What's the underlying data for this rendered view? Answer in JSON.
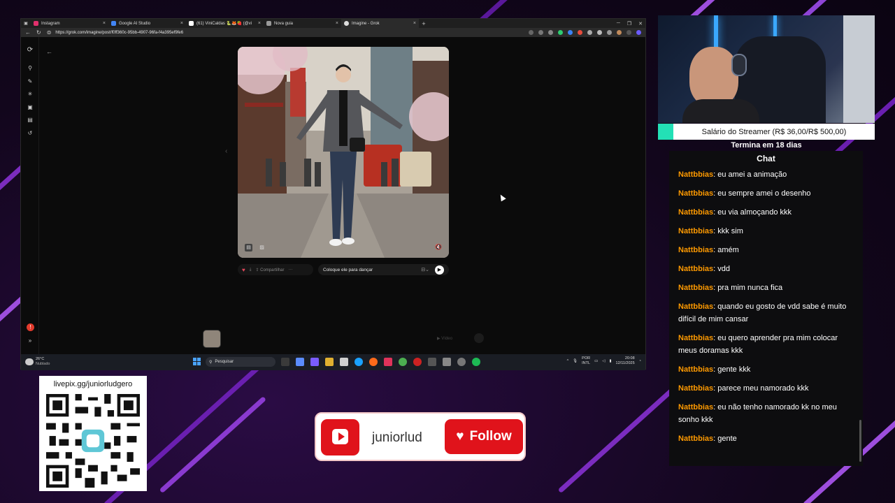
{
  "browser": {
    "tabs": [
      {
        "title": "Instagram",
        "fav_color": "#e1306c",
        "active": false
      },
      {
        "title": "Google AI Studio",
        "fav_color": "#4285f4",
        "active": false
      },
      {
        "title": "(61) ViniCaldas 🐍🦊🍓 (@vi",
        "fav_color": "#ffffff",
        "active": false
      },
      {
        "title": "Nova guia",
        "fav_color": "#999999",
        "active": false
      },
      {
        "title": "Imagine - Grok",
        "fav_color": "#dddddd",
        "active": true
      }
    ],
    "url": "https://grok.com/imagine/post/f0ff360c-95bb-4907-96fa-f4a395ef9fe6"
  },
  "grok": {
    "actions": {
      "share_label": "Compartilhar"
    },
    "prompt_text": "Coloque ele para dançar",
    "video_label": "Vídeo"
  },
  "taskbar": {
    "weather_temp": "26°C",
    "weather_desc": "Nublado",
    "search_label": "Pesquisar",
    "lang_top": "POR",
    "lang_bottom": "INTL",
    "time": "20:08",
    "date": "12/11/2025"
  },
  "stream": {
    "goal_label": "Salário do Streamer (R$ 36,00/R$ 500,00)",
    "goal_progress": 0.072,
    "goal_ends": "Termina em 18 dias",
    "chat_title": "Chat",
    "messages": [
      {
        "user": "Nattbbias",
        "text": ": eu amei a animação"
      },
      {
        "user": "Nattbbias",
        "text": ": eu sempre amei o desenho"
      },
      {
        "user": "Nattbbias",
        "text": ": eu via almoçando kkk"
      },
      {
        "user": "Nattbbias",
        "text": ": kkk sim"
      },
      {
        "user": "Nattbbias",
        "text": ": amém"
      },
      {
        "user": "Nattbbias",
        "text": ": vdd"
      },
      {
        "user": "Nattbbias",
        "text": ": pra mim nunca fica"
      },
      {
        "user": "Nattbbias",
        "text": ": quando eu gosto de vdd sabe é muito difícil de mim cansar"
      },
      {
        "user": "Nattbbias",
        "text": ": eu quero aprender pra mim colocar meus doramas kkk"
      },
      {
        "user": "Nattbbias",
        "text": ": gente kkk"
      },
      {
        "user": "Nattbbias",
        "text": ": parece meu namorado kkk"
      },
      {
        "user": "Nattbbias",
        "text": ": eu não tenho namorado kk no meu sonho kkk"
      },
      {
        "user": "Nattbbias",
        "text": ": gente"
      }
    ],
    "qr_url": "livepix.gg/juniorludgero",
    "channel": "juniorlud",
    "follow_label": "Follow"
  }
}
